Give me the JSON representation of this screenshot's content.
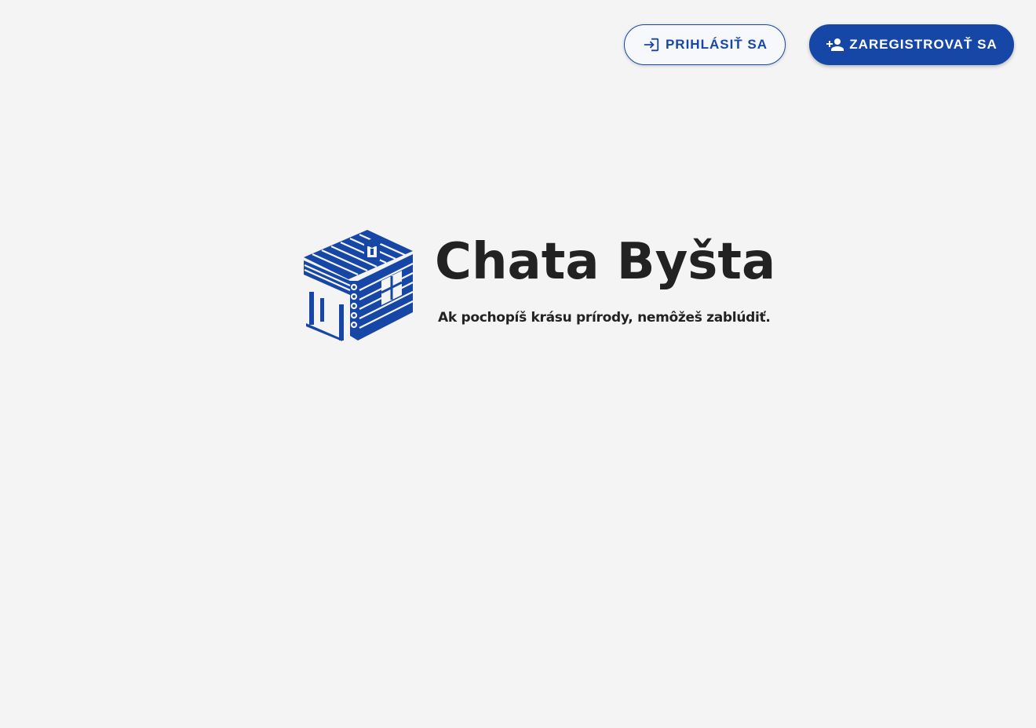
{
  "header": {
    "login_label": "PRIHLÁSIŤ SA",
    "login_icon": "login-icon",
    "register_label": "ZAREGISTROVAŤ SA",
    "register_icon": "person-add-icon"
  },
  "brand": {
    "logo_icon": "log-cabin-icon",
    "title": "Chata Byšta",
    "tagline": "Ak pochopíš krásu prírody, nemôžeš zablúdiť."
  },
  "colors": {
    "primary": "#1747a6",
    "background": "#f4f4f4",
    "text": "#222222"
  }
}
